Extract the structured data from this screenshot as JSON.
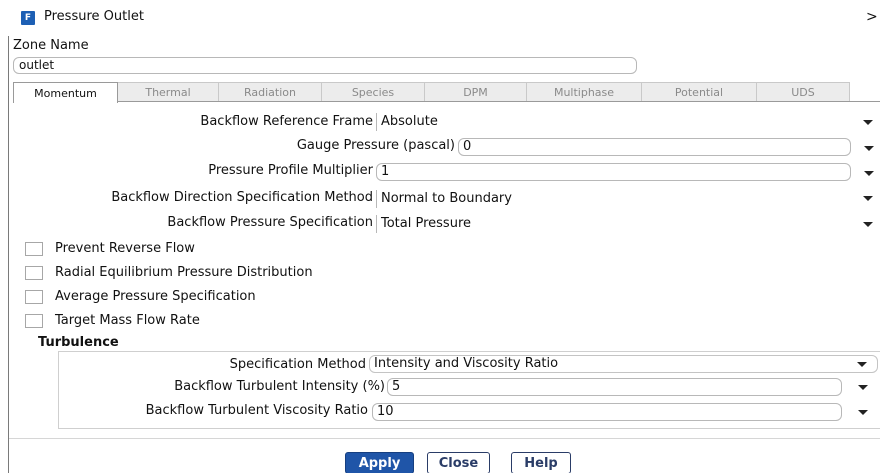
{
  "window": {
    "title": "Pressure Outlet",
    "icon_letter": "F"
  },
  "zone": {
    "label": "Zone Name",
    "value": "outlet"
  },
  "tabs": [
    {
      "label": "Momentum",
      "active": true
    },
    {
      "label": "Thermal",
      "active": false
    },
    {
      "label": "Radiation",
      "active": false
    },
    {
      "label": "Species",
      "active": false
    },
    {
      "label": "DPM",
      "active": false
    },
    {
      "label": "Multiphase",
      "active": false
    },
    {
      "label": "Potential",
      "active": false
    },
    {
      "label": "UDS",
      "active": false
    }
  ],
  "momentum": {
    "backflow_reference_frame": {
      "label": "Backflow Reference Frame",
      "value": "Absolute"
    },
    "gauge_pressure": {
      "label": "Gauge Pressure (pascal)",
      "value": "0"
    },
    "pressure_profile_multiplier": {
      "label": "Pressure Profile Multiplier",
      "value": "1"
    },
    "backflow_direction_method": {
      "label": "Backflow Direction Specification Method",
      "value": "Normal to Boundary"
    },
    "backflow_pressure_spec": {
      "label": "Backflow Pressure Specification",
      "value": "Total Pressure"
    },
    "checkboxes": [
      {
        "label": "Prevent Reverse Flow",
        "checked": false
      },
      {
        "label": "Radial Equilibrium Pressure Distribution",
        "checked": false
      },
      {
        "label": "Average Pressure Specification",
        "checked": false
      },
      {
        "label": "Target Mass Flow Rate",
        "checked": false
      }
    ]
  },
  "turbulence": {
    "title": "Turbulence",
    "specification_method": {
      "label": "Specification Method",
      "value": "Intensity and Viscosity Ratio"
    },
    "turbulent_intensity": {
      "label": "Backflow Turbulent Intensity (%)",
      "value": "5"
    },
    "turbulent_viscosity_ratio": {
      "label": "Backflow Turbulent Viscosity Ratio",
      "value": "10"
    }
  },
  "buttons": {
    "apply": "Apply",
    "close": "Close",
    "help": "Help"
  },
  "colors": {
    "primary_button": "#1f55a8",
    "app_icon": "#1d5fb4"
  }
}
